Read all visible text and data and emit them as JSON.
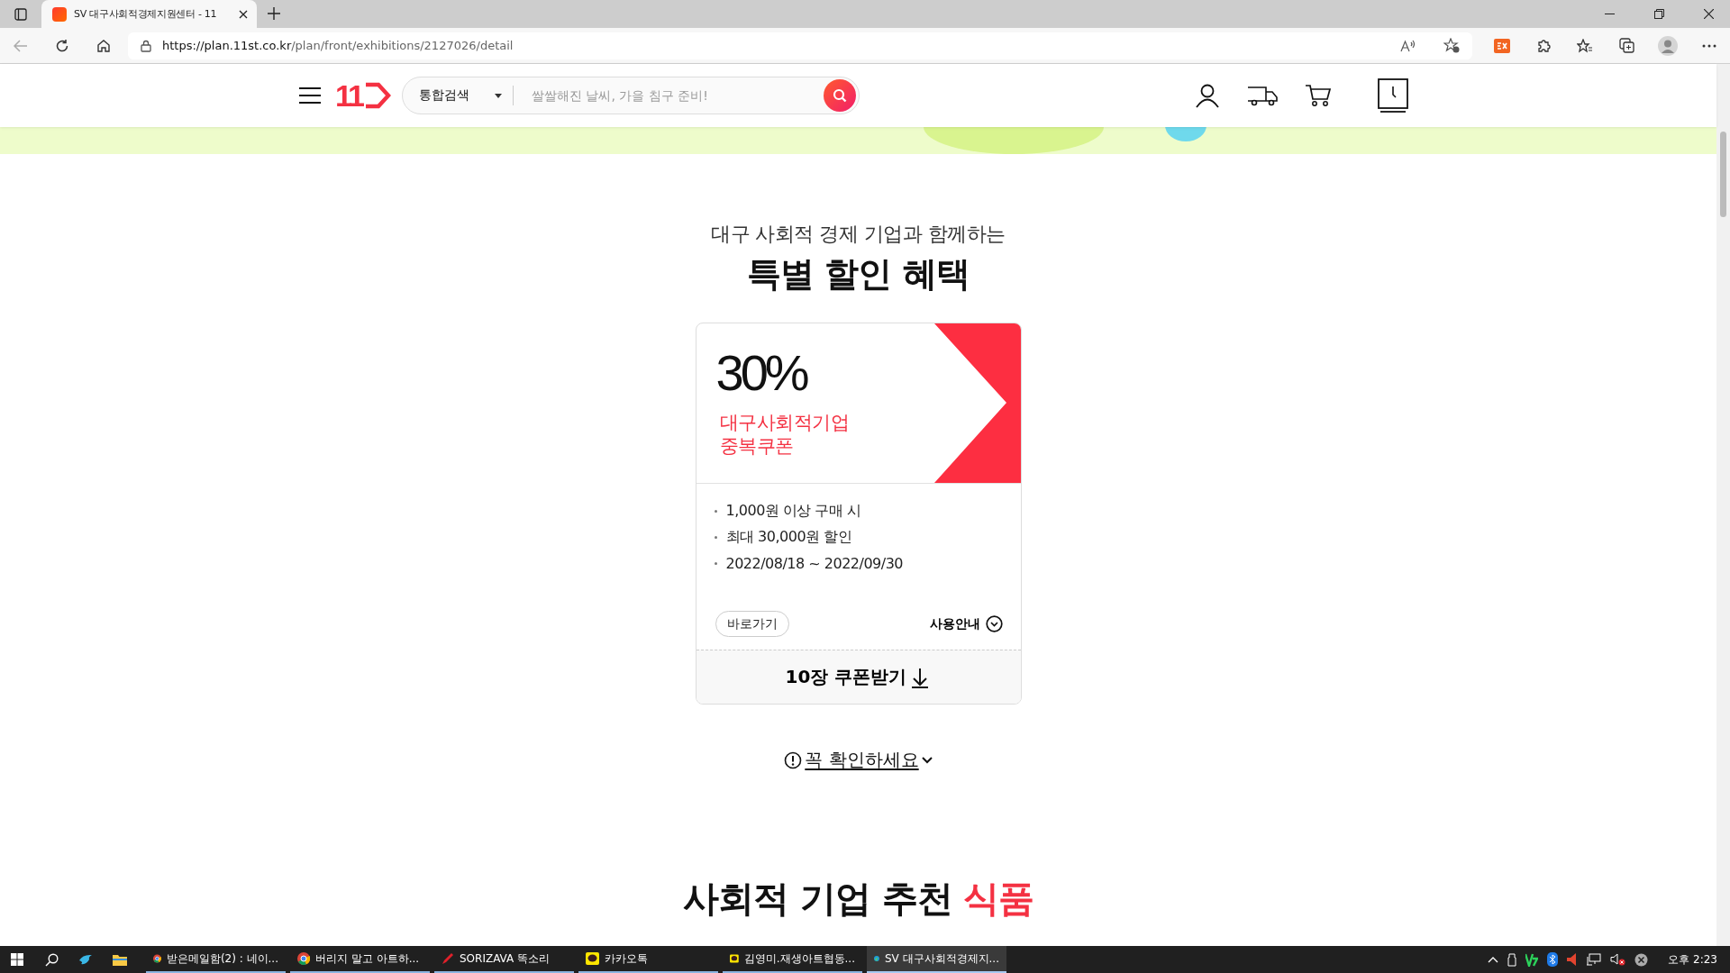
{
  "browser": {
    "tabs": [
      {
        "title": "SV 대구사회적경제지원센터 - 11",
        "selected": true
      }
    ],
    "url_host": "https://plan.11st.co.kr",
    "url_path": "/plan/front/exhibitions/2127026/detail"
  },
  "header": {
    "logo_text": "11",
    "search_category": "통합검색",
    "search_placeholder": "쌀쌀해진 날씨, 가을 침구 준비!"
  },
  "promo": {
    "subtitle": "대구 사회적 경제 기업과 함께하는",
    "title": "특별 할인 혜택"
  },
  "coupon": {
    "discount": "30%",
    "name_lines": [
      "대구사회적기업",
      "중복쿠폰"
    ],
    "conditions": [
      "1,000원 이상 구매 시",
      "최대 30,000원 할인",
      "2022/08/18 ~ 2022/09/30"
    ],
    "shortcut_button": "바로가기",
    "guide_button": "사용안내",
    "download_button": "10장 쿠폰받기"
  },
  "notice": {
    "label": "꼭 확인하세요"
  },
  "section": {
    "title": "사회적 기업 추천",
    "highlight": "식품"
  },
  "taskbar": {
    "windows": [
      {
        "kind": "chrome",
        "title": "받은메일함(2) : 네이...",
        "selected": false
      },
      {
        "kind": "chrome",
        "title": "버리지 말고 아트하...",
        "selected": false
      },
      {
        "kind": "pen",
        "title": "SORIZAVA 똑소리",
        "selected": false
      },
      {
        "kind": "chat",
        "title": "카카오톡",
        "selected": false
      },
      {
        "kind": "chat",
        "title": "김영미.재생아트협동...",
        "selected": false
      },
      {
        "kind": "edge",
        "title": "SV 대구사회적경제지...",
        "selected": true
      }
    ],
    "clock": "오후 2:23"
  }
}
